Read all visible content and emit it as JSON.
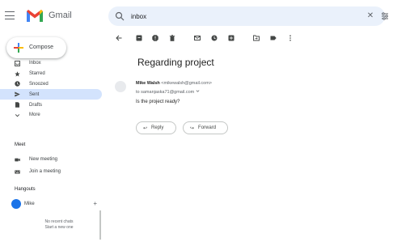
{
  "app": {
    "name": "Gmail",
    "colors": {
      "red": "#ea4335",
      "blue": "#4285f4",
      "green": "#34a853",
      "yellow": "#fbbc04",
      "active_bg": "#d3e3fd",
      "search_bg": "#eaf1fb"
    }
  },
  "search": {
    "value": "inbox"
  },
  "compose": {
    "label": "Compose"
  },
  "nav": {
    "items": [
      {
        "label": "Inbox",
        "icon": "inbox-icon",
        "active": false
      },
      {
        "label": "Starred",
        "icon": "star-icon",
        "active": false
      },
      {
        "label": "Snoozed",
        "icon": "clock-icon",
        "active": false
      },
      {
        "label": "Sent",
        "icon": "send-icon",
        "active": true
      },
      {
        "label": "Drafts",
        "icon": "draft-icon",
        "active": false
      },
      {
        "label": "More",
        "icon": "chevron-down-icon",
        "active": false
      }
    ]
  },
  "meet": {
    "title": "Meet",
    "items": [
      {
        "label": "New meeting",
        "icon": "video-icon"
      },
      {
        "label": "Join a meeting",
        "icon": "keyboard-icon"
      }
    ]
  },
  "hangouts": {
    "title": "Hangouts",
    "user_initial": "",
    "user_name": "Mike",
    "empty_line1": "No recent chats",
    "empty_line2": "Start a new one"
  },
  "email": {
    "subject": "Regarding project",
    "sender_name": "Mike Walsh",
    "sender_email": "<mikewalsh@gmail.com>",
    "to_line": "to samanjaska71@gmail.com",
    "body": "Is the project ready?",
    "reply_label": "Reply",
    "forward_label": "Forward"
  },
  "toolbar": {
    "icons": [
      "back-icon",
      "archive-icon",
      "report-spam-icon",
      "delete-icon",
      "mark-unread-icon",
      "snooze-icon",
      "add-task-icon",
      "move-to-icon",
      "labels-icon",
      "more-icon"
    ]
  }
}
